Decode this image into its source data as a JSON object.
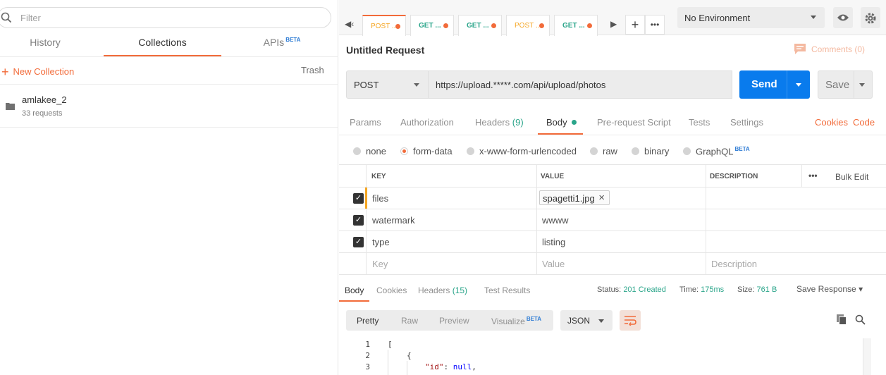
{
  "sidebar": {
    "filter_placeholder": "Filter",
    "tabs": [
      {
        "label": "History"
      },
      {
        "label": "Collections"
      },
      {
        "label": "APIs",
        "badge": "BETA"
      }
    ],
    "new_collection": "New Collection",
    "trash": "Trash",
    "collection": {
      "name": "amlakee_2",
      "count": "33 requests"
    }
  },
  "tabs": [
    {
      "method": "POST",
      "label": "POST",
      "ellipsis": "..."
    },
    {
      "method": "GET",
      "label": "GET",
      "ellipsis": "..."
    },
    {
      "method": "GET",
      "label": "GET",
      "ellipsis": "..."
    },
    {
      "method": "POST",
      "label": "POST",
      "ellipsis": "..."
    },
    {
      "method": "GET",
      "label": "GET",
      "ellipsis": "..."
    }
  ],
  "environment": {
    "selected": "No Environment"
  },
  "request": {
    "title": "Untitled Request",
    "comments": "Comments (0)",
    "method": "POST",
    "url": "https://upload.*****.com/api/upload/photos",
    "send": "Send",
    "save": "Save"
  },
  "request_tabs": {
    "params": "Params",
    "authorization": "Authorization",
    "headers": "Headers",
    "headers_count": "(9)",
    "body": "Body",
    "prerequest": "Pre-request Script",
    "tests": "Tests",
    "settings": "Settings",
    "cookies": "Cookies",
    "code": "Code"
  },
  "body_modes": {
    "none": "none",
    "form_data": "form-data",
    "urlencoded": "x-www-form-urlencoded",
    "raw": "raw",
    "binary": "binary",
    "graphql": "GraphQL",
    "graphql_badge": "BETA"
  },
  "form_table": {
    "headers": {
      "key": "KEY",
      "value": "VALUE",
      "description": "DESCRIPTION"
    },
    "more": "•••",
    "bulk_edit": "Bulk Edit",
    "rows": [
      {
        "key": "files",
        "value": "spagetti1.jpg"
      },
      {
        "key": "watermark",
        "value": "wwww"
      },
      {
        "key": "type",
        "value": "listing"
      }
    ],
    "placeholders": {
      "key": "Key",
      "value": "Value",
      "description": "Description"
    }
  },
  "response": {
    "tabs": {
      "body": "Body",
      "cookies": "Cookies",
      "headers": "Headers",
      "headers_count": "(15)",
      "test_results": "Test Results"
    },
    "status_label": "Status:",
    "status": "201 Created",
    "time_label": "Time:",
    "time": "175ms",
    "size_label": "Size:",
    "size": "761 B",
    "save_response": "Save Response"
  },
  "viewer": {
    "pretty": "Pretty",
    "raw": "Raw",
    "preview": "Preview",
    "visualize": "Visualize",
    "visualize_badge": "BETA",
    "format": "JSON"
  },
  "code_lines": [
    {
      "n": "1",
      "text": "["
    },
    {
      "n": "2",
      "text": "{"
    },
    {
      "n": "3",
      "key": "\"id\"",
      "colon": ": ",
      "value": "null",
      "comma": ","
    }
  ],
  "colors": {
    "accent": "#f26b3a",
    "send": "#097bed",
    "success": "#2aa58a"
  }
}
